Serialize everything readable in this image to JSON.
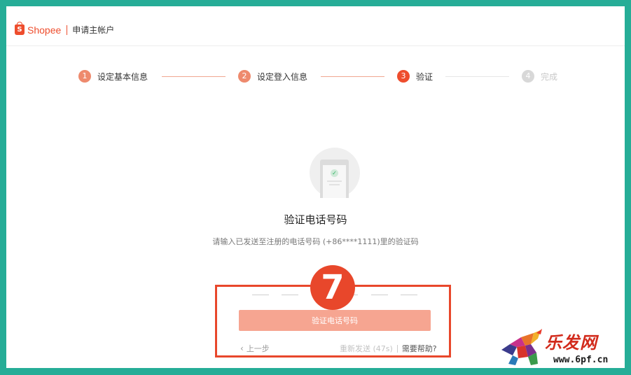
{
  "header": {
    "brand": "Shopee",
    "brand_mark": "S",
    "title": "申请主帐户"
  },
  "steps": [
    {
      "number": "1",
      "label": "设定基本信息",
      "state": "done"
    },
    {
      "number": "2",
      "label": "设定登入信息",
      "state": "done"
    },
    {
      "number": "3",
      "label": "验证",
      "state": "active"
    },
    {
      "number": "4",
      "label": "完成",
      "state": "todo"
    }
  ],
  "phone_icon": {
    "name": "phone-check-icon",
    "check": "✓"
  },
  "main": {
    "title": "验证电话号码",
    "description": "请输入已发送至注册的电话号码 (+86****1111)里的验证码",
    "otp_length": 6,
    "verify_button": "验证电话号码",
    "back_arrow": "‹",
    "back_label": "上一步",
    "resend_label": "重新发送 (47s)",
    "help_label": "需要帮助?"
  },
  "annotation": {
    "badge": "7",
    "color": "#e8472b"
  },
  "watermark": {
    "text": "乐发网",
    "url": "www.6pf.cn"
  },
  "colors": {
    "brand": "#ee4d2d",
    "frame": "#26ad97",
    "button": "#f6a591",
    "step_done": "#ee8a6d",
    "step_todo": "#d8d8d8"
  }
}
